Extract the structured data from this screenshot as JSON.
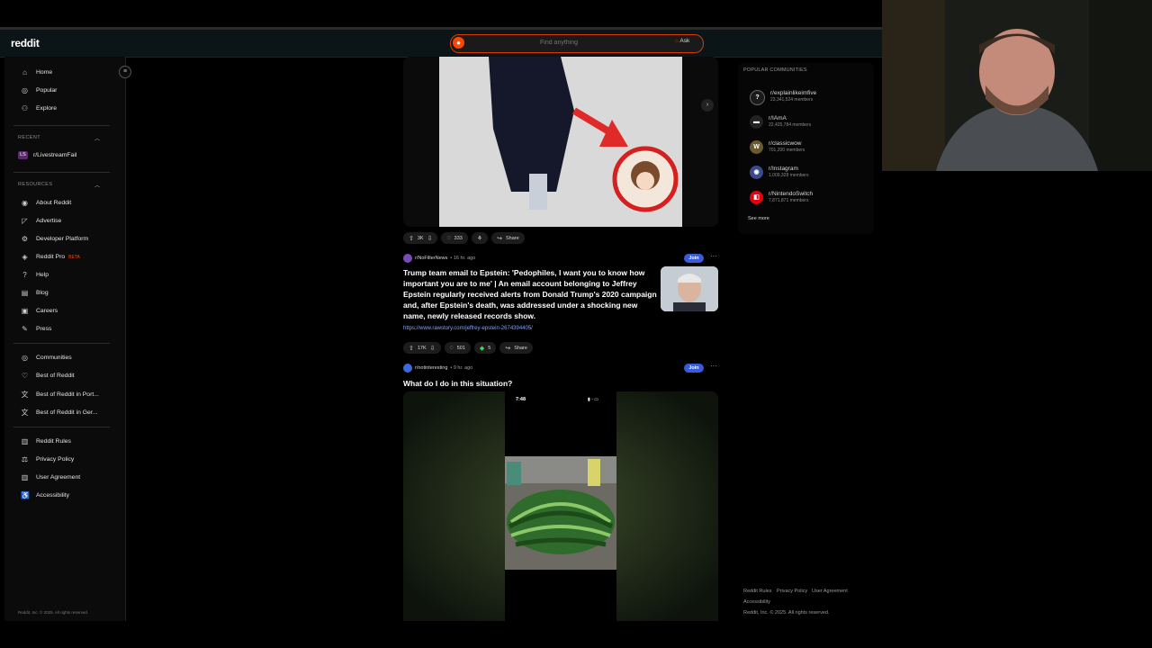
{
  "app": {
    "logo": "reddit"
  },
  "search": {
    "placeholder": "Find anything",
    "ask_label": "Ask"
  },
  "sidebar": {
    "main": [
      {
        "icon": "home-icon",
        "label": "Home"
      },
      {
        "icon": "popular-icon",
        "label": "Popular"
      },
      {
        "icon": "explore-icon",
        "label": "Explore"
      }
    ],
    "recent_heading": "RECENT",
    "recent": [
      {
        "badge": "LS",
        "label": "r/LivestreamFail"
      }
    ],
    "resources_heading": "RESOURCES",
    "resources": [
      {
        "icon": "about-icon",
        "label": "About Reddit"
      },
      {
        "icon": "advertise-icon",
        "label": "Advertise"
      },
      {
        "icon": "developer-icon",
        "label": "Developer Platform"
      },
      {
        "icon": "reddit-pro-icon",
        "label": "Reddit Pro",
        "tag": "BETA"
      },
      {
        "icon": "help-icon",
        "label": "Help"
      },
      {
        "icon": "blog-icon",
        "label": "Blog"
      },
      {
        "icon": "careers-icon",
        "label": "Careers"
      },
      {
        "icon": "press-icon",
        "label": "Press"
      }
    ],
    "communities": [
      {
        "icon": "communities-icon",
        "label": "Communities"
      },
      {
        "icon": "best-of-icon",
        "label": "Best of Reddit"
      },
      {
        "icon": "translate-icon",
        "label": "Best of Reddit in Port..."
      },
      {
        "icon": "translate-icon",
        "label": "Best of Reddit in Ger..."
      }
    ],
    "legal": [
      {
        "icon": "rules-icon",
        "label": "Reddit Rules"
      },
      {
        "icon": "privacy-icon",
        "label": "Privacy Policy"
      },
      {
        "icon": "agreement-icon",
        "label": "User Agreement"
      },
      {
        "icon": "accessibility-icon",
        "label": "Accessibility"
      }
    ],
    "copyright": "Reddit, Inc. © 2025. All rights reserved."
  },
  "post1": {
    "upvotes": "3K",
    "comments": "333",
    "share": "Share"
  },
  "post2": {
    "subreddit": "r/NoFilterNews",
    "age": "• 16 hr. ago",
    "join": "Join",
    "title": "Trump team email to Epstein: 'Pedophiles, I want you to know how important you are to me' | An email account belonging to Jeffrey Epstein regularly received alerts from Donald Trump's 2020 campaign and, after Epstein's death, was addressed under a shocking new name, newly released records show.",
    "link": "https://www.rawstory.com/jeffrey-epstein-2674394405/",
    "upvotes": "17K",
    "comments": "501",
    "awards": "5",
    "share": "Share"
  },
  "post3": {
    "subreddit": "r/notinteresting",
    "age": "• 9 hr. ago",
    "join": "Join",
    "title": "What do I do in this situation?",
    "phone_time": "7:48"
  },
  "popular": {
    "heading": "POPULAR COMMUNITIES",
    "items": [
      {
        "name": "r/explainlikeimfive",
        "members": "23,341,524 members",
        "color": "#1a1a1a",
        "glyph": "?"
      },
      {
        "name": "r/IAmA",
        "members": "22,425,784 members",
        "color": "#222222",
        "glyph": "▬"
      },
      {
        "name": "r/classicwow",
        "members": "701,200 members",
        "color": "#6b5a2e",
        "glyph": "W"
      },
      {
        "name": "r/Instagram",
        "members": "1,009,328 members",
        "color": "#3b4a8c",
        "glyph": "◉"
      },
      {
        "name": "r/NintendoSwitch",
        "members": "7,871,871 members",
        "color": "#e4000f",
        "glyph": "◧"
      }
    ],
    "see_more": "See more"
  },
  "footer": {
    "links": [
      "Reddit Rules",
      "Privacy Policy",
      "User Agreement",
      "Accessibility"
    ],
    "copyright": "Reddit, Inc. © 2025. All rights reserved."
  },
  "colors": {
    "accent": "#ff4500",
    "join": "#3a5bd9",
    "background": "#000000"
  }
}
